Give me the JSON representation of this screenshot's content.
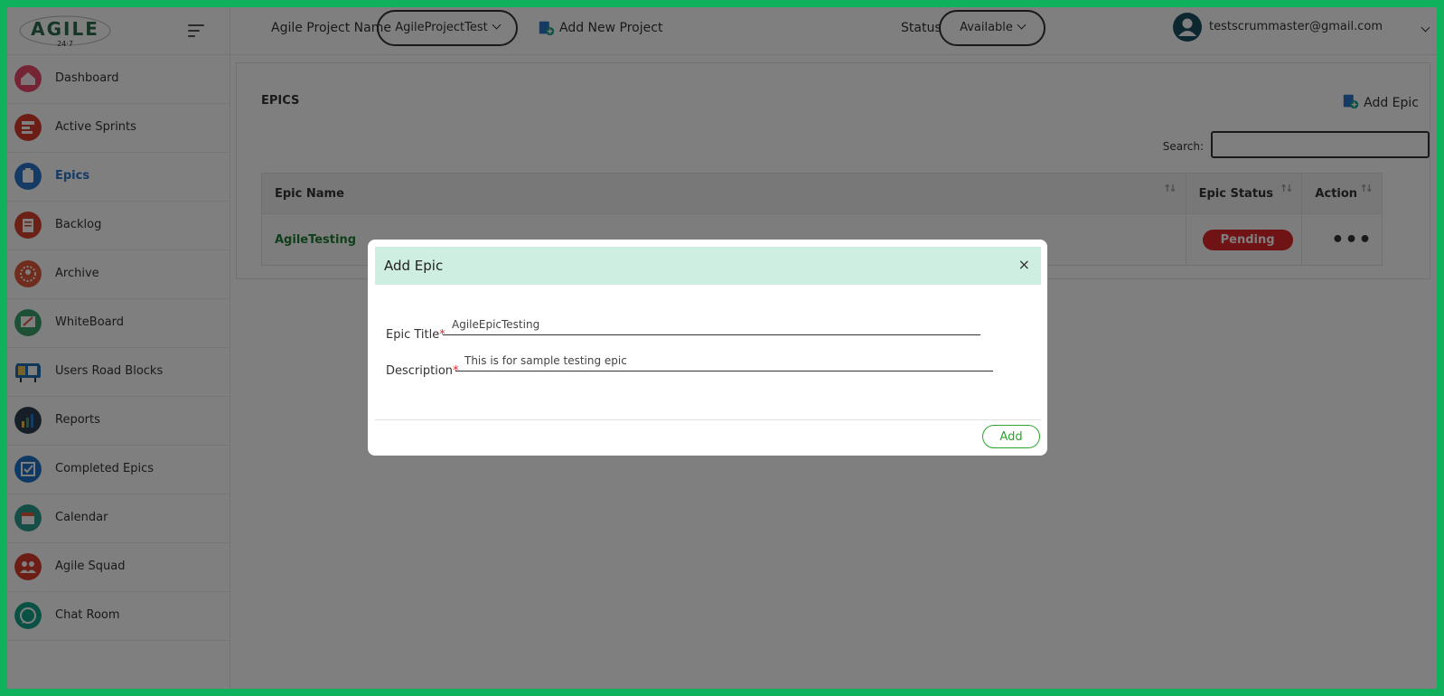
{
  "brand": {
    "logo_text": "AGILE",
    "logo_sub": "24·7"
  },
  "sidebar": {
    "items": [
      {
        "label": "Dashboard",
        "icon": "dashboard-icon",
        "color": "#e8486b"
      },
      {
        "label": "Active Sprints",
        "icon": "sprints-icon",
        "color": "#d93b2b"
      },
      {
        "label": "Epics",
        "icon": "epics-icon",
        "color": "#2b74c9",
        "active": true
      },
      {
        "label": "Backlog",
        "icon": "backlog-icon",
        "color": "#d9432e"
      },
      {
        "label": "Archive",
        "icon": "archive-icon",
        "color": "#e05a3a"
      },
      {
        "label": "WhiteBoard",
        "icon": "whiteboard-icon",
        "color": "#3aa06a"
      },
      {
        "label": "Users Road Blocks",
        "icon": "roadblocks-icon",
        "color": "#1f6fb5"
      },
      {
        "label": "Reports",
        "icon": "reports-icon",
        "color": "#2c3e50"
      },
      {
        "label": "Completed Epics",
        "icon": "completed-epics-icon",
        "color": "#1f73c4"
      },
      {
        "label": "Calendar",
        "icon": "calendar-icon",
        "color": "#2a9d8f"
      },
      {
        "label": "Agile Squad",
        "icon": "squad-icon",
        "color": "#d93b2b"
      },
      {
        "label": "Chat Room",
        "icon": "chat-icon",
        "color": "#13a38a"
      }
    ]
  },
  "topbar": {
    "project_label": "Agile Project Name",
    "project_value": "AgileProjectTest",
    "add_project": "Add New Project",
    "status_label": "Status",
    "status_value": "Available",
    "user_email": "testscrummaster@gmail.com"
  },
  "epics": {
    "title": "EPICS",
    "add_epic": "Add Epic",
    "search_label": "Search:",
    "columns": [
      "Epic Name",
      "Epic Status",
      "Action"
    ],
    "rows": [
      {
        "name": "AgileTesting",
        "status": "Pending",
        "action": "•••"
      }
    ]
  },
  "modal": {
    "title": "Add Epic",
    "close": "×",
    "epic_title_label": "Epic Title",
    "epic_title_value": "AgileEpicTesting",
    "description_label": "Description",
    "description_value": "This is for sample testing epic",
    "required_mark": "*",
    "add_button": "Add"
  },
  "colors": {
    "accent_green": "#10b15c",
    "modal_header": "#cdeee1",
    "pending_red": "#e0262b",
    "active_blue": "#2b74c9"
  }
}
